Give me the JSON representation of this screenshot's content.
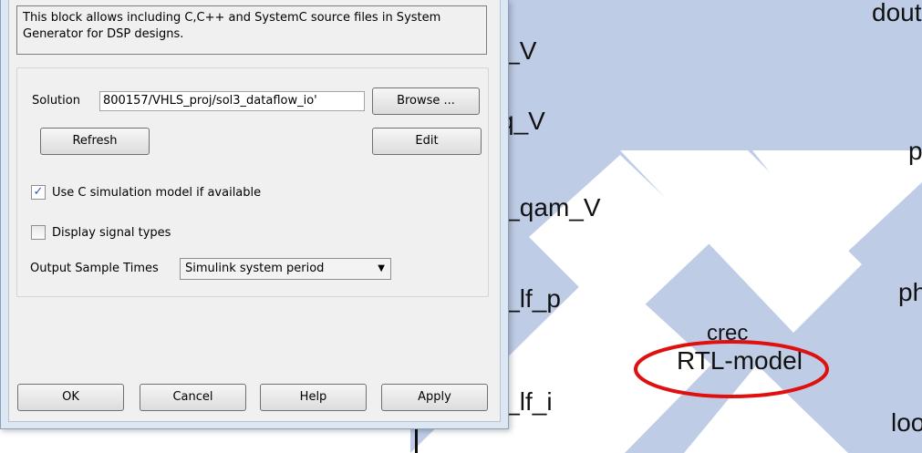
{
  "dialog": {
    "description": "This block allows including C,C++ and SystemC source files in System Generator for DSP designs.",
    "solution_label": "Solution",
    "solution_value": "800157/VHLS_proj/sol3_dataflow_io'",
    "browse_label": "Browse ...",
    "refresh_label": "Refresh",
    "edit_label": "Edit",
    "use_c_sim_label": "Use C simulation model if available",
    "use_c_sim_checked": true,
    "display_signal_label": "Display signal types",
    "display_signal_checked": false,
    "output_sample_label": "Output Sample Times",
    "output_sample_value": "Simulink system period",
    "ok_label": "OK",
    "cancel_label": "Cancel",
    "help_label": "Help",
    "apply_label": "Apply"
  },
  "canvas": {
    "ports_left": [
      "i_V",
      "q_V",
      "l_qam_V",
      "l_lf_p",
      "l_lf_i"
    ],
    "ports_right": [
      "dout",
      "p",
      "ph",
      "loo"
    ],
    "block_name": "crec",
    "block_subtitle": "RTL-model",
    "highlight_color": "#e01010",
    "canvas_color": "#bfcce6"
  },
  "icons": {
    "checkbox_check": "✓",
    "dropdown_arrow": "▼"
  }
}
